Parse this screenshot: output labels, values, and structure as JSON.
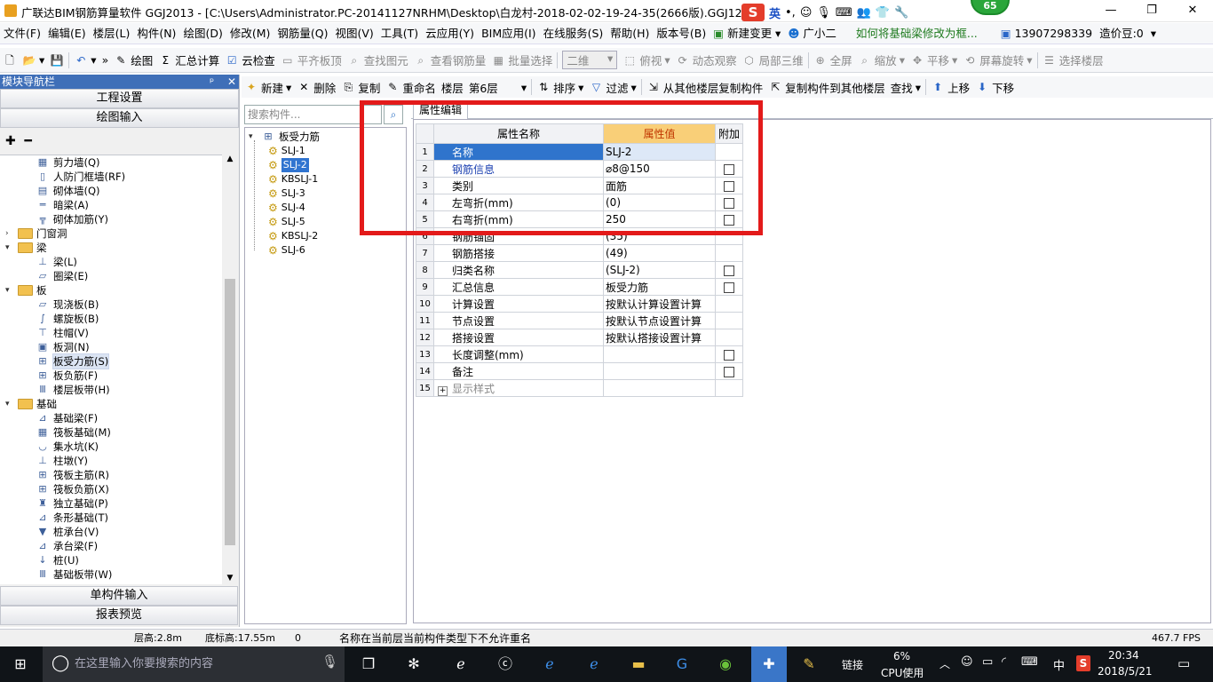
{
  "window": {
    "title": "广联达BIM钢筋算量软件 GGJ2013 - [C:\\Users\\Administrator.PC-20141127NRHM\\Desktop\\白龙村-2018-02-02-19-24-35(2666版).GGJ12]",
    "badge": "65",
    "ime_label": "英",
    "minimize": "—",
    "restore": "❐",
    "close": "✕"
  },
  "menu": [
    "文件(F)",
    "编辑(E)",
    "楼层(L)",
    "构件(N)",
    "绘图(D)",
    "修改(M)",
    "钢筋量(Q)",
    "视图(V)",
    "工具(T)",
    "云应用(Y)",
    "BIM应用(I)",
    "在线服务(S)",
    "帮助(H)",
    "版本号(B)",
    "新建变更",
    "广小二",
    "如何将基础梁修改为框...",
    "13907298339",
    "造价豆:0"
  ],
  "toolbar": {
    "draw": "绘图",
    "sum": "汇总计算",
    "cloudcheck": "云检查",
    "flat": "平齐板顶",
    "find": "查找图元",
    "viewrebar": "查看钢筋量",
    "batch": "批量选择",
    "mode": "二维",
    "top": "俯视",
    "dyn": "动态观察",
    "local3d": "局部三维",
    "full": "全屏",
    "zoom": "缩放",
    "pan": "平移",
    "rotate": "屏幕旋转",
    "selfloor": "选择楼层"
  },
  "toolbar2": {
    "new": "新建",
    "delete": "删除",
    "copy": "复制",
    "rename": "重命名",
    "floor_label": "楼层",
    "floor": "第6层",
    "sort": "排序",
    "filter": "过滤",
    "copy_from": "从其他楼层复制构件",
    "copy_to": "复制构件到其他楼层",
    "find": "查找",
    "up": "上移",
    "down": "下移"
  },
  "nav": {
    "header": "模块导航栏",
    "pin": "ᵖ",
    "close": "✕",
    "btn_settings": "工程设置",
    "btn_draw": "绘图输入",
    "btn_single": "单构件输入",
    "btn_report": "报表预览",
    "tree": [
      {
        "label": "剪力墙(Q)",
        "icon": "▦"
      },
      {
        "label": "人防门框墙(RF)",
        "icon": "▯"
      },
      {
        "label": "砌体墙(Q)",
        "icon": "▤"
      },
      {
        "label": "暗梁(A)",
        "icon": "═"
      },
      {
        "label": "砌体加筋(Y)",
        "icon": "╦"
      },
      {
        "label": "门窗洞",
        "folder": true,
        "expand": ">"
      },
      {
        "label": "梁",
        "folder": true,
        "expand": "v"
      },
      {
        "label": "梁(L)",
        "icon": "⊥"
      },
      {
        "label": "圈梁(E)",
        "icon": "▱"
      },
      {
        "label": "板",
        "folder": true,
        "expand": "v"
      },
      {
        "label": "现浇板(B)",
        "icon": "▱"
      },
      {
        "label": "螺旋板(B)",
        "icon": "∫"
      },
      {
        "label": "柱帽(V)",
        "icon": "⊤"
      },
      {
        "label": "板洞(N)",
        "icon": "▣"
      },
      {
        "label": "板受力筋(S)",
        "icon": "⊞",
        "selected": true
      },
      {
        "label": "板负筋(F)",
        "icon": "⊞"
      },
      {
        "label": "楼层板带(H)",
        "icon": "Ⅲ"
      },
      {
        "label": "基础",
        "folder": true,
        "expand": "v"
      },
      {
        "label": "基础梁(F)",
        "icon": "⊿"
      },
      {
        "label": "筏板基础(M)",
        "icon": "▦"
      },
      {
        "label": "集水坑(K)",
        "icon": "◡"
      },
      {
        "label": "柱墩(Y)",
        "icon": "⊥"
      },
      {
        "label": "筏板主筋(R)",
        "icon": "⊞"
      },
      {
        "label": "筏板负筋(X)",
        "icon": "⊞"
      },
      {
        "label": "独立基础(P)",
        "icon": "♜"
      },
      {
        "label": "条形基础(T)",
        "icon": "⊿"
      },
      {
        "label": "桩承台(V)",
        "icon": "▼"
      },
      {
        "label": "承台梁(F)",
        "icon": "⊿"
      },
      {
        "label": "桩(U)",
        "icon": "↓"
      },
      {
        "label": "基础板带(W)",
        "icon": "Ⅲ"
      }
    ]
  },
  "list": {
    "search_placeholder": "搜索构件...",
    "root": "板受力筋",
    "items": [
      "SLJ-1",
      "SLJ-2",
      "KBSLJ-1",
      "SLJ-3",
      "SLJ-4",
      "SLJ-5",
      "KBSLJ-2",
      "SLJ-6"
    ],
    "selected_index": 1
  },
  "props": {
    "tab": "属性编辑",
    "col_name": "属性名称",
    "col_value": "属性值",
    "col_extra": "附加",
    "rows": [
      {
        "n": "1",
        "name": "名称",
        "value": "SLJ-2",
        "cb": false,
        "current": true
      },
      {
        "n": "2",
        "name": "钢筋信息",
        "value": "⌀8@150",
        "cb": true,
        "blue": true
      },
      {
        "n": "3",
        "name": "类别",
        "value": "面筋",
        "cb": true
      },
      {
        "n": "4",
        "name": "左弯折(mm)",
        "value": "(0)",
        "cb": true
      },
      {
        "n": "5",
        "name": "右弯折(mm)",
        "value": "250",
        "cb": true
      },
      {
        "n": "6",
        "name": "钢筋锚固",
        "value": "(35)",
        "cb": false
      },
      {
        "n": "7",
        "name": "钢筋搭接",
        "value": "(49)",
        "cb": false
      },
      {
        "n": "8",
        "name": "归类名称",
        "value": "(SLJ-2)",
        "cb": true
      },
      {
        "n": "9",
        "name": "汇总信息",
        "value": "板受力筋",
        "cb": true
      },
      {
        "n": "10",
        "name": "计算设置",
        "value": "按默认计算设置计算",
        "cb": false
      },
      {
        "n": "11",
        "name": "节点设置",
        "value": "按默认节点设置计算",
        "cb": false
      },
      {
        "n": "12",
        "name": "搭接设置",
        "value": "按默认搭接设置计算",
        "cb": false
      },
      {
        "n": "13",
        "name": "长度调整(mm)",
        "value": "",
        "cb": true
      },
      {
        "n": "14",
        "name": "备注",
        "value": "",
        "cb": true
      },
      {
        "n": "15",
        "name": "显示样式",
        "value": "",
        "cb": false,
        "gray": true,
        "expander": "+"
      }
    ]
  },
  "status": {
    "floor_h": "层高:2.8m",
    "base_h": "底标高:17.55m",
    "zero": "0",
    "msg": "名称在当前层当前构件类型下不允许重名",
    "fps": "467.7 FPS"
  },
  "taskbar": {
    "search": "在这里输入你要搜索的内容",
    "link": "链接",
    "cpu_pct": "6%",
    "cpu_label": "CPU使用",
    "lang": "中",
    "time": "20:34",
    "date": "2018/5/21"
  }
}
